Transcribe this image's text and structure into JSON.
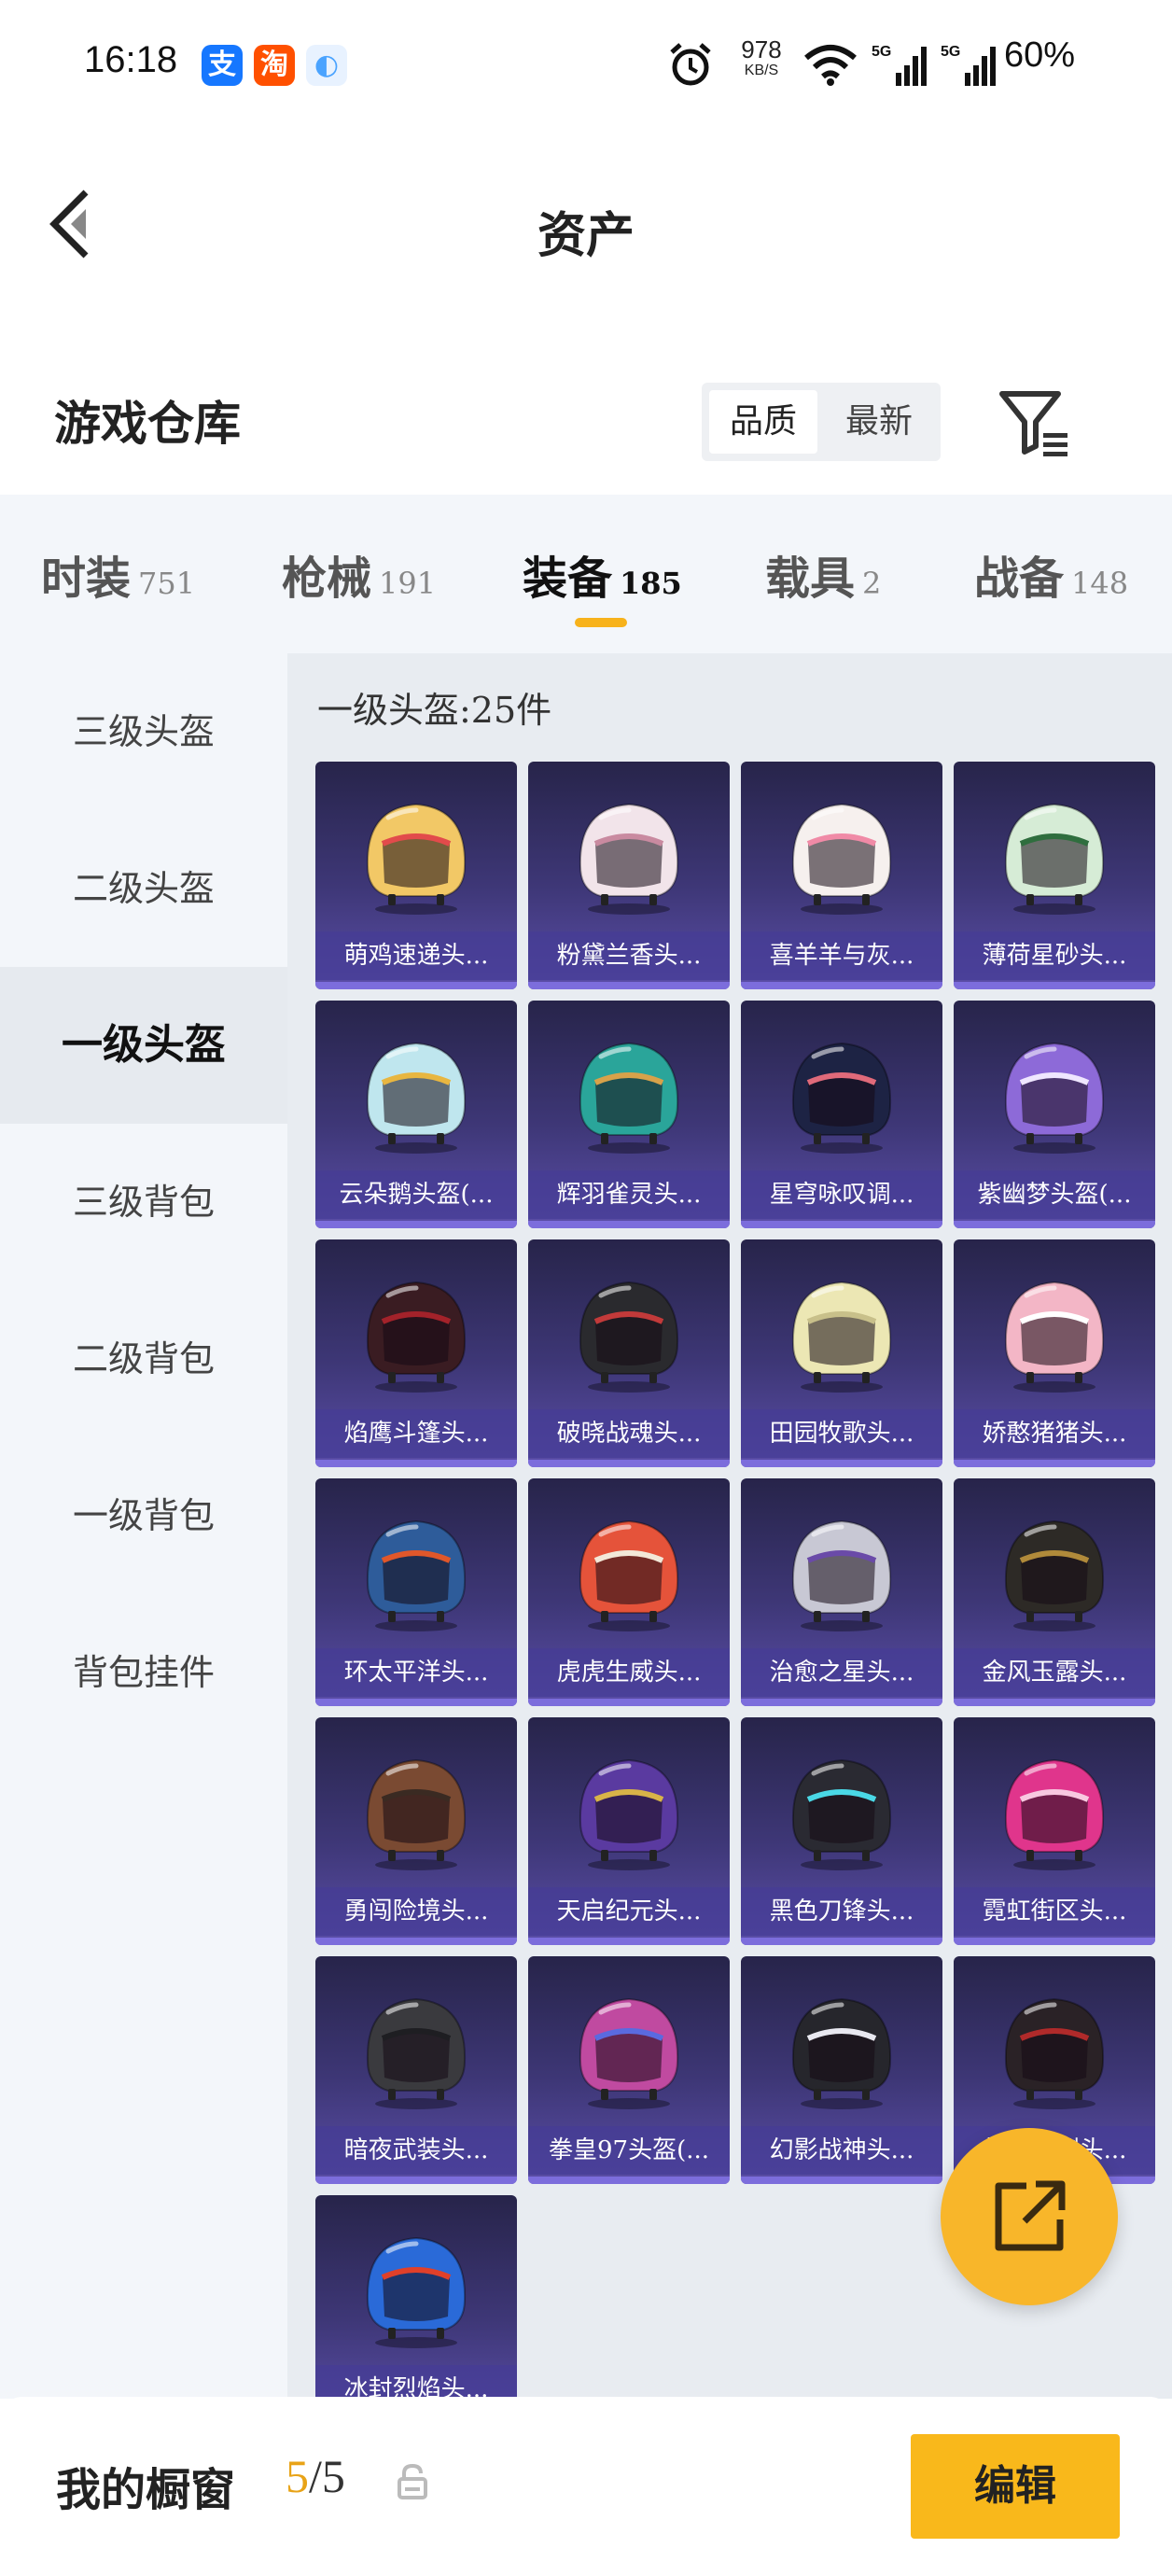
{
  "status_bar": {
    "time": "16:18",
    "apps": [
      {
        "icon": "alipay-icon",
        "glyph": "支",
        "color": "#1677ff"
      },
      {
        "icon": "taobao-icon",
        "glyph": "淘",
        "color": "#ff5000"
      },
      {
        "icon": "cloud-app-icon",
        "glyph": "◐",
        "color": "#4aa3ff"
      }
    ],
    "net_speed": "978",
    "net_unit": "KB/S",
    "battery": "60%"
  },
  "header": {
    "title": "资产"
  },
  "warehouse": {
    "title": "游戏仓库",
    "sort_options": [
      {
        "label": "品质",
        "active": true
      },
      {
        "label": "最新",
        "active": false
      }
    ]
  },
  "tabs": [
    {
      "label": "时装",
      "count": "751",
      "active": false
    },
    {
      "label": "枪械",
      "count": "191",
      "active": false
    },
    {
      "label": "装备",
      "count": "185",
      "active": true
    },
    {
      "label": "载具",
      "count": "2",
      "active": false
    },
    {
      "label": "战备",
      "count": "148",
      "active": false
    }
  ],
  "sidebar": {
    "items": [
      {
        "label": "三级头盔",
        "active": false
      },
      {
        "label": "二级头盔",
        "active": false
      },
      {
        "label": "一级头盔",
        "active": true
      },
      {
        "label": "三级背包",
        "active": false
      },
      {
        "label": "二级背包",
        "active": false
      },
      {
        "label": "一级背包",
        "active": false
      },
      {
        "label": "背包挂件",
        "active": false
      }
    ]
  },
  "content": {
    "heading": "一级头盔:25件",
    "items": [
      {
        "name": "萌鸡速递头...",
        "color": "#f2c866",
        "accent": "#e24b4b"
      },
      {
        "name": "粉黛兰香头...",
        "color": "#f2e4ea",
        "accent": "#c98aa0"
      },
      {
        "name": "喜羊羊与灰...",
        "color": "#f6f0ee",
        "accent": "#f08aa6"
      },
      {
        "name": "薄荷星砂头...",
        "color": "#d6ecd6",
        "accent": "#2f6e3e"
      },
      {
        "name": "云朵鹅头盔(...",
        "color": "#bfe6ee",
        "accent": "#e8b640"
      },
      {
        "name": "辉羽雀灵头...",
        "color": "#2aa59a",
        "accent": "#d7a24a"
      },
      {
        "name": "星穹咏叹调...",
        "color": "#1d2344",
        "accent": "#e06a7a"
      },
      {
        "name": "紫幽梦头盔(...",
        "color": "#8d6ad8",
        "accent": "#efe6ff"
      },
      {
        "name": "焰鹰斗篷头...",
        "color": "#3a1c22",
        "accent": "#a3222a"
      },
      {
        "name": "破晓战魂头...",
        "color": "#2a2a2e",
        "accent": "#c23a3a"
      },
      {
        "name": "田园牧歌头...",
        "color": "#ece7b4",
        "accent": "#c8c08a"
      },
      {
        "name": "娇憨猪猪头...",
        "color": "#f3b6c6",
        "accent": "#ffffff"
      },
      {
        "name": "环太平洋头...",
        "color": "#2e5c9a",
        "accent": "#e0572a"
      },
      {
        "name": "虎虎生威头...",
        "color": "#e5533a",
        "accent": "#f3e8d8"
      },
      {
        "name": "治愈之星头...",
        "color": "#c8c8d4",
        "accent": "#6a4aa8"
      },
      {
        "name": "金风玉露头...",
        "color": "#2d2a26",
        "accent": "#b08a3a"
      },
      {
        "name": "勇闯险境头...",
        "color": "#7a4a32",
        "accent": "#3a2a22"
      },
      {
        "name": "天启纪元头...",
        "color": "#5a3aa0",
        "accent": "#d8b448"
      },
      {
        "name": "黑色刀锋头...",
        "color": "#2a2a32",
        "accent": "#4ad8e6"
      },
      {
        "name": "霓虹街区头...",
        "color": "#e0358c",
        "accent": "#f8c8e0"
      },
      {
        "name": "暗夜武装头...",
        "color": "#3a3a3e",
        "accent": "#1e1e22"
      },
      {
        "name": "拳皇97头盔(...",
        "color": "#c04aa0",
        "accent": "#5a6ae0"
      },
      {
        "name": "幻影战神头...",
        "color": "#26262c",
        "accent": "#e8e8f0"
      },
      {
        "name": "赫羽战渊头...",
        "color": "#2a2226",
        "accent": "#b02a2a"
      },
      {
        "name": "冰封烈焰头...",
        "color": "#2a6ad8",
        "accent": "#e0402a"
      }
    ]
  },
  "share_button": {
    "icon": "share-external-icon"
  },
  "bottom_bar": {
    "title": "我的橱窗",
    "count": "5",
    "separator": "/",
    "total": "5",
    "edit_label": "编辑"
  }
}
